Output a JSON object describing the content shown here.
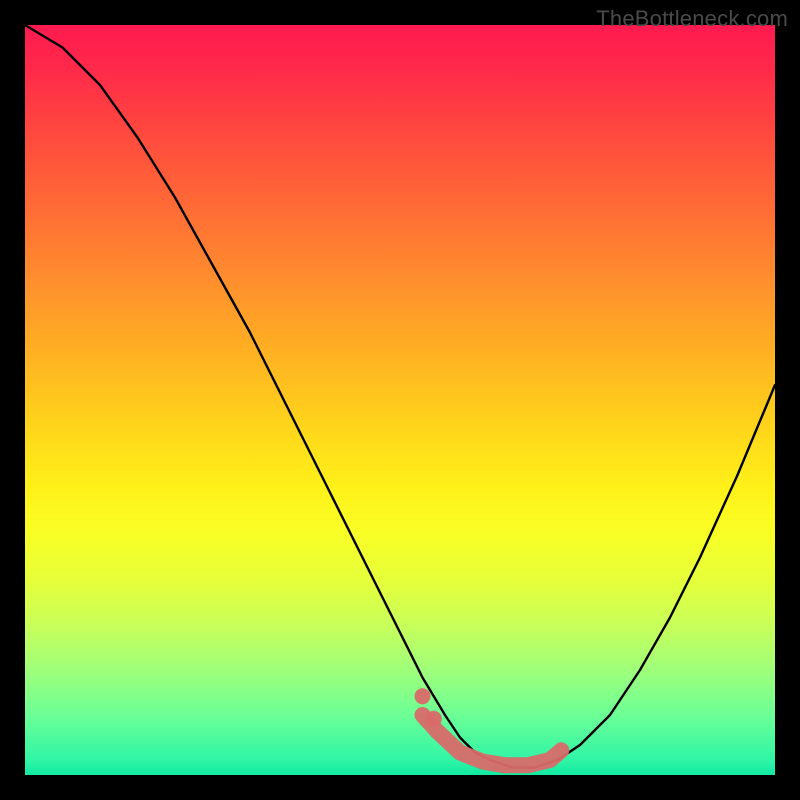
{
  "watermark": "TheBottleneck.com",
  "colors": {
    "curve": "#000000",
    "marker": "#d96a6a",
    "background_frame": "#000000"
  },
  "chart_data": {
    "type": "line",
    "title": "",
    "xlabel": "",
    "ylabel": "",
    "xlim": [
      0,
      100
    ],
    "ylim": [
      0,
      100
    ],
    "note": "Values estimated from the gradient-backed V-curve; y is bottleneck% (0 = green/bottom, 100 = red/top). The minimum (sweet spot) lies roughly at x 60–71.",
    "series": [
      {
        "name": "bottleneck_curve",
        "x": [
          0,
          5,
          10,
          15,
          20,
          25,
          30,
          35,
          40,
          45,
          50,
          53,
          56,
          58,
          60,
          62,
          65,
          68,
          71,
          74,
          78,
          82,
          86,
          90,
          95,
          100
        ],
        "y": [
          100,
          97,
          92,
          85,
          77,
          68,
          59,
          49,
          39,
          29,
          19,
          13,
          8,
          5,
          3,
          2,
          1,
          1,
          2,
          4,
          8,
          14,
          21,
          29,
          40,
          52
        ]
      }
    ],
    "markers": {
      "name": "optimal_zone",
      "style": "thick-pink-dots",
      "x": [
        53,
        55,
        58,
        61,
        64,
        67,
        70,
        71.5
      ],
      "y": [
        8,
        5.8,
        3,
        1.8,
        1.3,
        1.3,
        2,
        3.3
      ]
    }
  }
}
